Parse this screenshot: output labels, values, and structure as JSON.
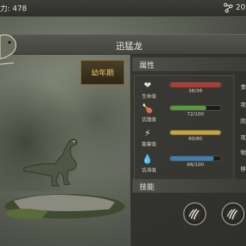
{
  "topbar": {
    "power_text": "力: 478",
    "dna_value": "20"
  },
  "header": {
    "dino_name": "迅猛龙"
  },
  "stage": {
    "label": "幼年期"
  },
  "attributes": {
    "title": "属性",
    "stats": [
      {
        "label": "生命值",
        "value": "36/36",
        "fraction": 1.0,
        "color": "#b83a2e",
        "icon": "heart-icon"
      },
      {
        "label": "饥饿值",
        "value": "72/100",
        "fraction": 0.72,
        "color": "#5b9a3c",
        "icon": "drumstick-icon"
      },
      {
        "label": "能量值",
        "value": "80/80",
        "fraction": 1.0,
        "color": "#c8a43a",
        "icon": "lightning-icon"
      },
      {
        "label": "饥渴值",
        "value": "86/100",
        "fraction": 0.86,
        "color": "#3f7fb0",
        "icon": "droplet-icon"
      }
    ],
    "right_labels": [
      "食",
      "攻",
      "防",
      "攻",
      "物",
      "移"
    ]
  },
  "skills": {
    "title": "技能",
    "items": [
      "claw-icon",
      "claw-icon"
    ]
  }
}
